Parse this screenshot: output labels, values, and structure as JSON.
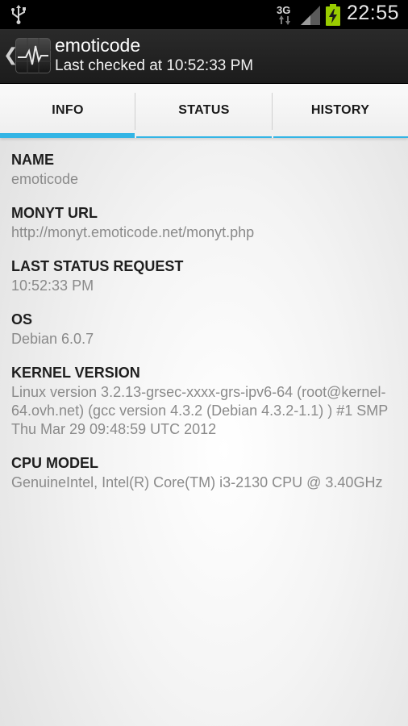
{
  "status_bar": {
    "network_type": "3G",
    "time": "22:55"
  },
  "action_bar": {
    "title": "emoticode",
    "subtitle": "Last checked at 10:52:33 PM"
  },
  "tabs": [
    {
      "label": "INFO",
      "selected": true
    },
    {
      "label": "STATUS",
      "selected": false
    },
    {
      "label": "HISTORY",
      "selected": false
    }
  ],
  "fields": [
    {
      "label": "NAME",
      "value": "emoticode"
    },
    {
      "label": "MONYT URL",
      "value": "http://monyt.emoticode.net/monyt.php"
    },
    {
      "label": "LAST STATUS REQUEST",
      "value": "10:52:33 PM"
    },
    {
      "label": "OS",
      "value": "Debian 6.0.7"
    },
    {
      "label": "KERNEL VERSION",
      "value": "Linux version 3.2.13-grsec-xxxx-grs-ipv6-64 (root@kernel-64.ovh.net) (gcc version 4.3.2 (Debian 4.3.2-1.1) ) #1 SMP Thu Mar 29 09:48:59 UTC 2012"
    },
    {
      "label": "CPU MODEL",
      "value": "GenuineIntel, Intel(R) Core(TM) i3-2130 CPU @ 3.40GHz"
    }
  ],
  "colors": {
    "accent": "#33b5e5",
    "battery": "#99cc00",
    "label": "#1e1e1e",
    "value": "#8a8a8a"
  },
  "icons": [
    "usb-icon",
    "signal-icon",
    "battery-charging-icon",
    "chevron-left-icon",
    "heartbeat-app-icon"
  ]
}
